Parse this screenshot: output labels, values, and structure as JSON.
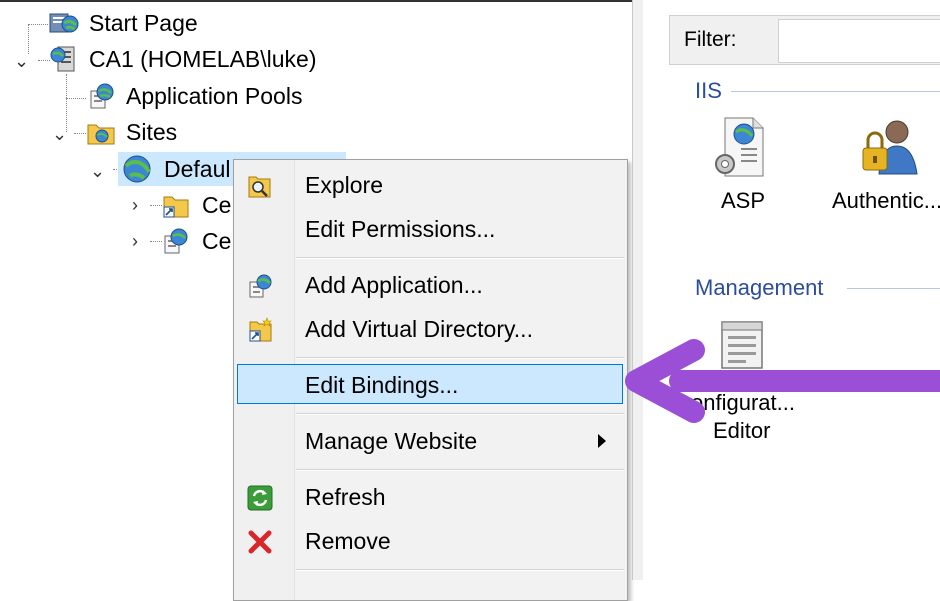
{
  "tree": {
    "start_page": "Start Page",
    "server": "CA1 (HOMELAB\\luke)",
    "app_pools": "Application Pools",
    "sites": "Sites",
    "default_site": "Defaul",
    "child1": "Ce",
    "child2": "Ce"
  },
  "context_menu": {
    "items": [
      {
        "label": "Explore",
        "icon": "explore-icon"
      },
      {
        "label": "Edit Permissions...",
        "icon": ""
      },
      {
        "label": "Add Application...",
        "icon": "add-application-icon"
      },
      {
        "label": "Add Virtual Directory...",
        "icon": "add-virtual-directory-icon"
      },
      {
        "label": "Edit Bindings...",
        "icon": "",
        "highlighted": true
      },
      {
        "label": "Manage Website",
        "icon": "",
        "submenu": true
      },
      {
        "label": "Refresh",
        "icon": "refresh-icon"
      },
      {
        "label": "Remove",
        "icon": "remove-icon"
      }
    ]
  },
  "right_pane": {
    "filter_label": "Filter:",
    "groups": [
      {
        "title": "IIS",
        "features": [
          {
            "label": "ASP"
          },
          {
            "label": "Authentic..."
          }
        ]
      },
      {
        "title": "Management",
        "features": [
          {
            "label_line1": "onfigurat...",
            "label_line2": "Editor"
          }
        ]
      }
    ]
  },
  "colors": {
    "highlight_fill": "#cce8ff",
    "highlight_border": "#0078d7",
    "group_header": "#2c4c9c",
    "arrow": "#9b4fd6",
    "remove_red": "#d9262b",
    "refresh_green": "#3a9d3a"
  }
}
